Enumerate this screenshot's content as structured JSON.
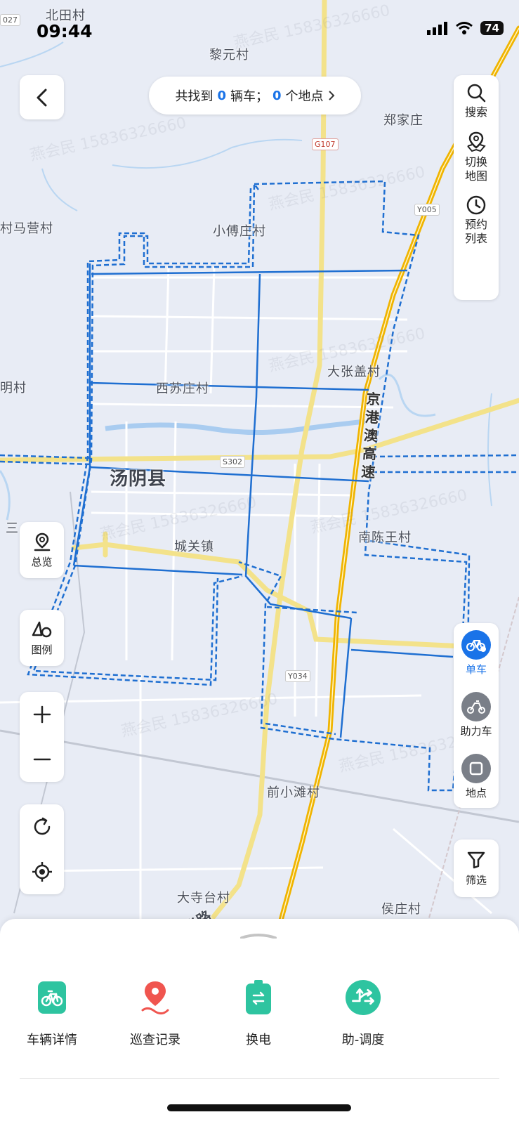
{
  "status": {
    "time": "09:44",
    "battery": "74"
  },
  "header": {
    "back_label": "back",
    "summary_prefix": "共找到",
    "vehicle_count": "0",
    "vehicle_unit": "辆车；",
    "place_count": "0",
    "place_unit": "个地点"
  },
  "right_tools": [
    {
      "label": "搜索",
      "icon": "search-icon"
    },
    {
      "label": "切换地图",
      "icon": "map-pin-switch-icon"
    },
    {
      "label": "预约列表",
      "icon": "clock-icon"
    }
  ],
  "left_tools": {
    "overview": "总览",
    "legend": "图例"
  },
  "vehicle_types": {
    "bike": "单车",
    "ebike": "助力车",
    "place": "地点"
  },
  "filter": {
    "label": "筛选"
  },
  "map_labels": {
    "beitian": "北田村",
    "liyuan": "黎元村",
    "zhengjiazhuang": "郑家庄",
    "mayingcun": "村马营村",
    "xiaofuzhuang": "小傅庄村",
    "dazhanggai": "大张盖村",
    "mingcun": "明村",
    "xisuzhuang": "西苏庄村",
    "tangyin": "汤阴县",
    "chengguan": "城关镇",
    "nanchenwang": "南陈王村",
    "san": "三",
    "qianxiaotan": "前小滩村",
    "dasitai": "大寺台村",
    "houzhuang": "侯庄村",
    "hualu": "华路",
    "highway": [
      "京",
      "港",
      "澳",
      "高",
      "速"
    ]
  },
  "road_tags": {
    "g107": "G107",
    "y005": "Y005",
    "s302": "S302",
    "y034": "Y034",
    "y027": "027"
  },
  "watermark": "燕会民 15836326660",
  "bottom_actions": [
    {
      "label": "车辆详情",
      "icon": "bike-detail-icon",
      "color": "#2ec4a0"
    },
    {
      "label": "巡查记录",
      "icon": "patrol-pin-icon",
      "color": "#f0554f"
    },
    {
      "label": "换电",
      "icon": "battery-swap-icon",
      "color": "#2ec4a0"
    },
    {
      "label": "助-调度",
      "icon": "dispatch-icon",
      "color": "#2ec4a0"
    }
  ],
  "colors": {
    "accent": "#1a73e8",
    "fence": "#1f6fd1",
    "highway": "#f0b400",
    "road": "#f3e28a"
  }
}
